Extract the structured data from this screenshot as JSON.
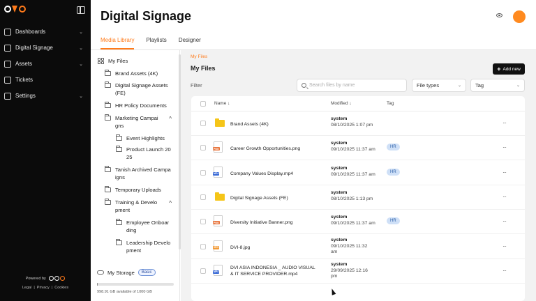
{
  "sidebar": {
    "items": [
      {
        "label": "Dashboards",
        "icon": "dashboard-icon",
        "has_chevron": true
      },
      {
        "label": "Digital Signage",
        "icon": "monitor-icon",
        "has_chevron": true
      },
      {
        "label": "Assets",
        "icon": "assets-icon",
        "has_chevron": true
      },
      {
        "label": "Tickets",
        "icon": "ticket-icon",
        "has_chevron": false
      },
      {
        "label": "Settings",
        "icon": "gear-icon",
        "has_chevron": true
      }
    ],
    "powered_by": "Powered by",
    "links": [
      "Legal",
      "Privacy",
      "Cookies"
    ]
  },
  "header": {
    "title": "Digital Signage",
    "tabs": [
      "Media Library",
      "Playlists",
      "Designer"
    ],
    "active_tab": "Media Library"
  },
  "tree": {
    "root": "My Files",
    "items": [
      {
        "label": "Brand Assets (4K)"
      },
      {
        "label": "Digital Signage Assets\n(FE)"
      },
      {
        "label": "HR Policy Documents"
      },
      {
        "label": "Marketing Campai\ngns",
        "expanded": true
      },
      {
        "label": "Event Highlights",
        "child": true
      },
      {
        "label": "Product Launch 20\n25",
        "child": true
      },
      {
        "label": "Tanish Archived Campa\nigns"
      },
      {
        "label": "Temporary Uploads"
      },
      {
        "label": "Training & Develo\npment",
        "expanded": true
      },
      {
        "label": "Employee Onboar\nding",
        "child": true
      },
      {
        "label": "Leadership Develo\npment",
        "child": true
      }
    ],
    "storage_label": "My Storage",
    "storage_badge": "Basic",
    "storage_text": "998.91 GB available of 1000 GB",
    "storage_used_fraction": 0.001
  },
  "main": {
    "breadcrumb": "My Files",
    "title": "My Files",
    "add_button": "Add new",
    "filter_label": "Filter",
    "search_placeholder": "Search files by name",
    "file_types": "File types",
    "tag_select": "Tag",
    "columns": {
      "name": "Name ↓",
      "modified": "Modified ↓",
      "tag": "Tag"
    },
    "rows": [
      {
        "type": "folder",
        "name": "Brand Assets (4K)",
        "by": "system",
        "date": "08/10/2025 1:07 pm",
        "tag": ""
      },
      {
        "type": "PNG",
        "name": "Career Growth Opportunities.png",
        "by": "system",
        "date": "09/10/2025 11:37 am",
        "tag": "HR"
      },
      {
        "type": "MP4",
        "name": "Company Values Display.mp4",
        "by": "system",
        "date": "09/10/2025 11:37 am",
        "tag": "HR"
      },
      {
        "type": "folder",
        "name": "Digital Signage Assets (FE)",
        "by": "system",
        "date": "08/10/2025 1:13 pm",
        "tag": ""
      },
      {
        "type": "PNG",
        "name": "Diversity Initiative Banner.png",
        "by": "system",
        "date": "09/10/2025 11:37 am",
        "tag": "HR"
      },
      {
        "type": "JPG",
        "name": "DVI-8.jpg",
        "by": "system",
        "date": "09/10/2025 11:32\nam",
        "tag": ""
      },
      {
        "type": "MP4",
        "name": "DVI ASIA INDONESIA _ AUDIO VISUAL\n& IT SERVICE PROVIDER.mp4",
        "by": "system",
        "date": "29/09/2025 12:16\npm",
        "tag": ""
      }
    ]
  },
  "colors": {
    "accent": "#ff7a1a",
    "png": "#e8733a",
    "mp4": "#3a6ad6",
    "jpg": "#f29b38",
    "folder": "#f5c518"
  }
}
